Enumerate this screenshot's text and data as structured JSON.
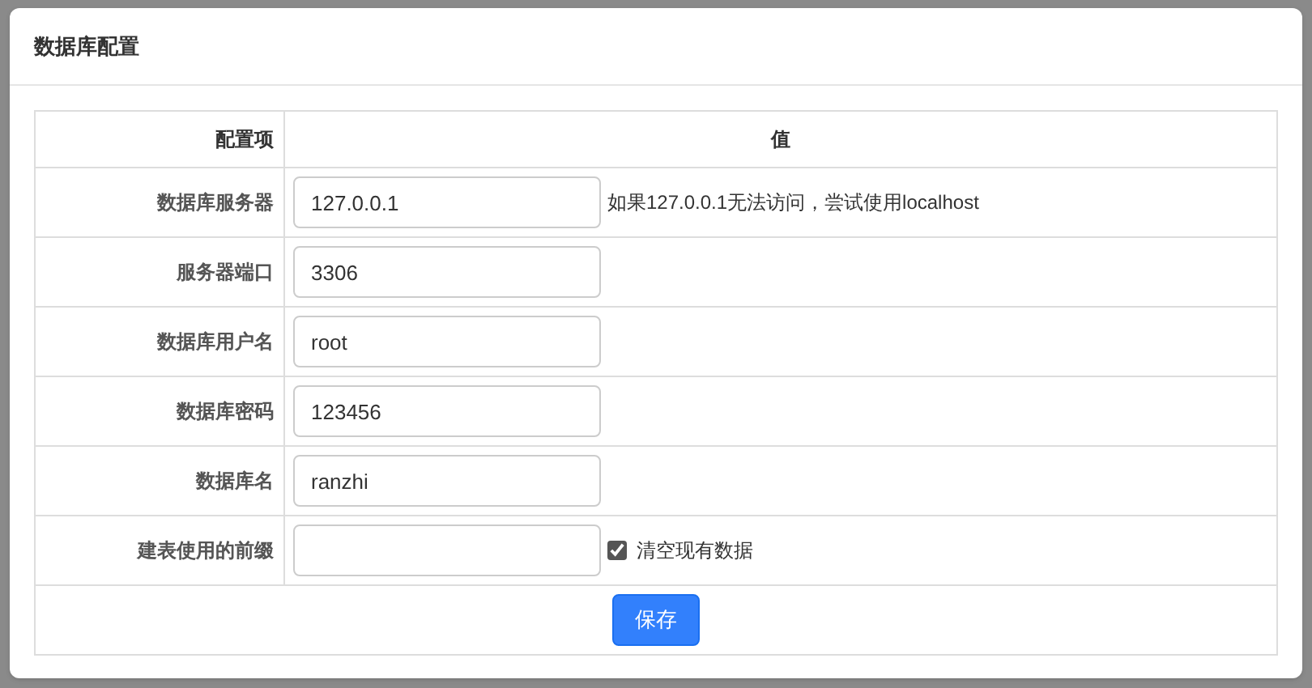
{
  "panel": {
    "title": "数据库配置"
  },
  "table": {
    "columns": [
      "配置项",
      "值"
    ],
    "rows": [
      {
        "label": "数据库服务器",
        "value": "127.0.0.1",
        "note": "如果127.0.0.1无法访问，尝试使用localhost"
      },
      {
        "label": "服务器端口",
        "value": "3306"
      },
      {
        "label": "数据库用户名",
        "value": "root"
      },
      {
        "label": "数据库密码",
        "value": "123456"
      },
      {
        "label": "数据库名",
        "value": "ranzhi"
      },
      {
        "label": "建表使用的前缀",
        "value": "",
        "checkbox": {
          "label": "清空现有数据",
          "checked": true
        }
      }
    ]
  },
  "save_button": "保存"
}
